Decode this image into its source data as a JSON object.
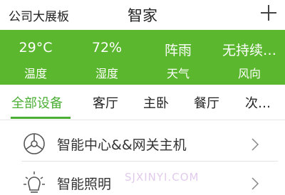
{
  "header": {
    "left_label": "公司大展板",
    "title": "智家",
    "add_icon": "plus-icon"
  },
  "weather": {
    "background": "#5bb72e",
    "items": [
      {
        "value": "29°C",
        "label": "温度"
      },
      {
        "value": "72%",
        "label": "湿度"
      },
      {
        "value": "阵雨",
        "label": "天气"
      },
      {
        "value": "无持续…",
        "label": "风向"
      }
    ]
  },
  "tabs": [
    {
      "label": "全部设备",
      "active": true
    },
    {
      "label": "客厅",
      "active": false
    },
    {
      "label": "主卧",
      "active": false
    },
    {
      "label": "餐厅",
      "active": false
    },
    {
      "label": "次…",
      "active": false
    }
  ],
  "accent_color": "#4caf35",
  "devices": [
    {
      "label": "智能中心&&网关主机",
      "icon": "hub-icon"
    },
    {
      "label": "智能照明",
      "icon": "lightbulb-icon"
    }
  ],
  "watermark": "SJXINYI.COM"
}
